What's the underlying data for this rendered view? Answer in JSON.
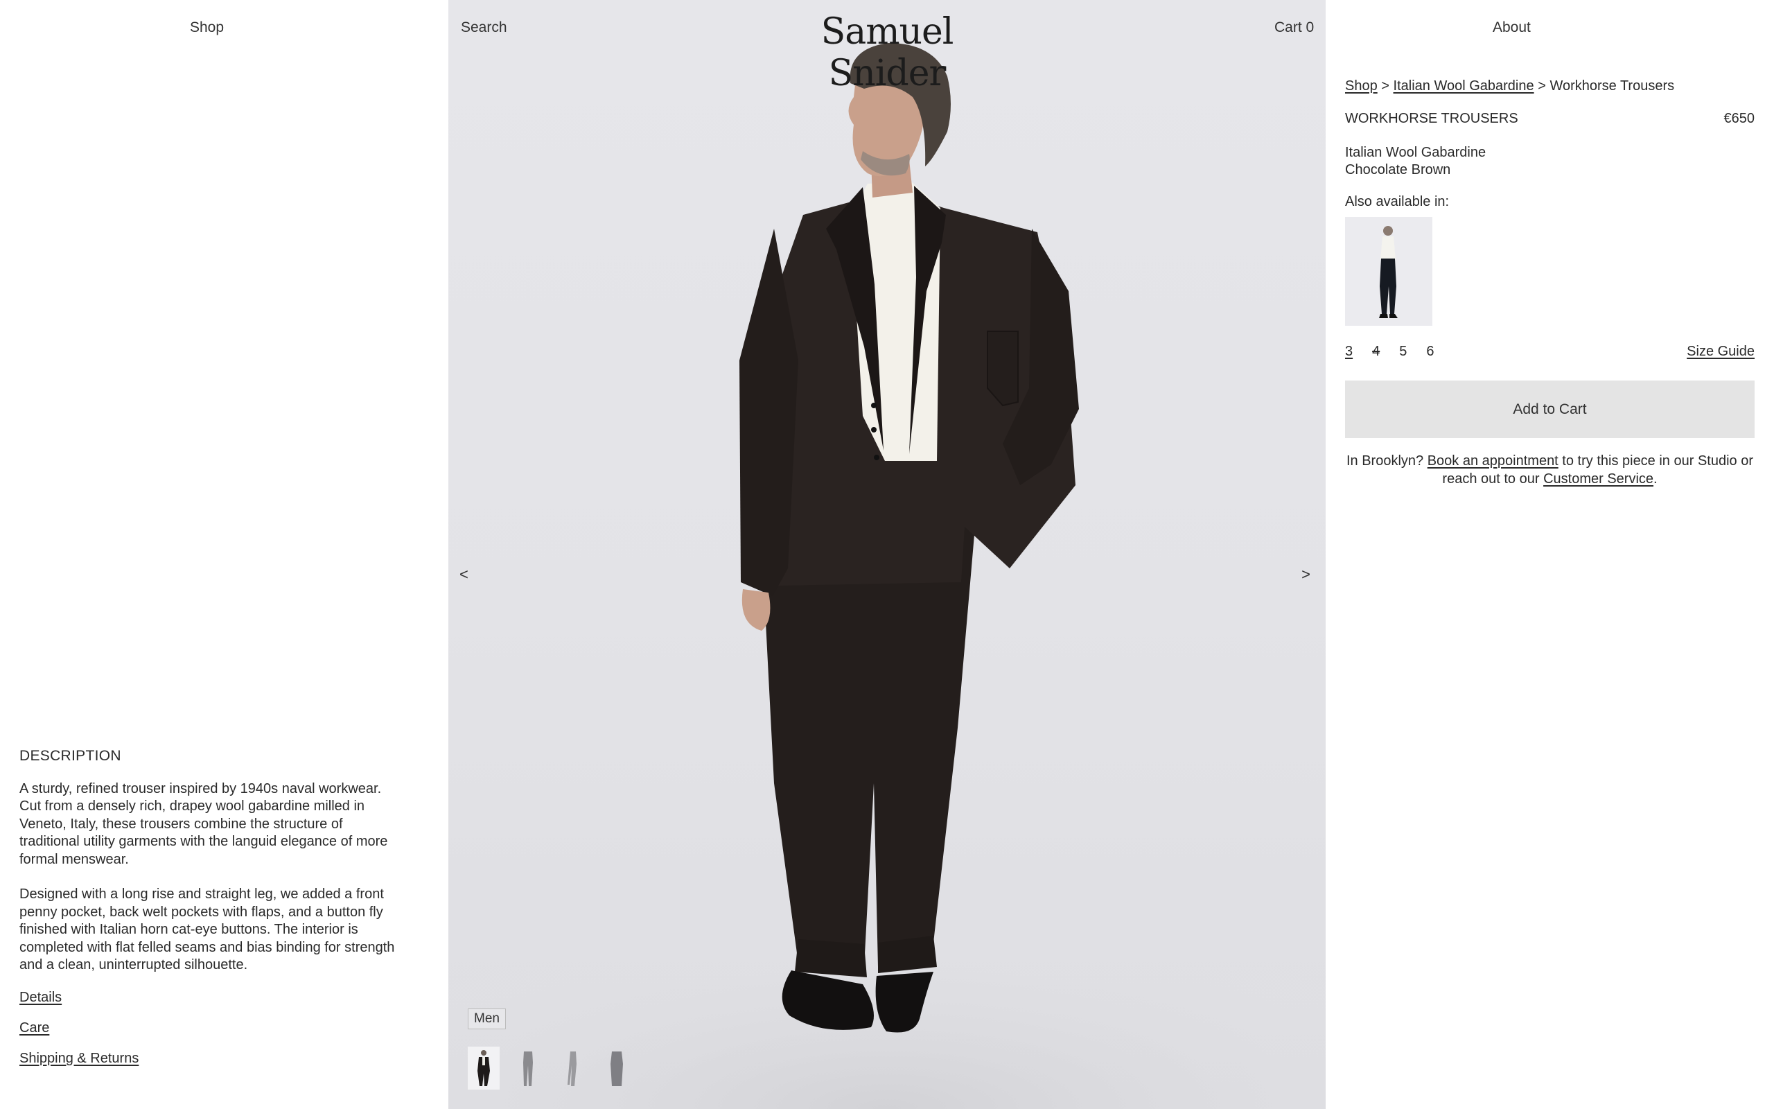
{
  "header": {
    "nav_left": "Shop",
    "nav_search": "Search",
    "brand": "Samuel Snider",
    "cart": "Cart 0",
    "nav_about": "About"
  },
  "gallery": {
    "prev": "<",
    "next": ">",
    "tag": "Men",
    "thumbnail_count": 4,
    "active_thumbnail": 1
  },
  "description": {
    "heading": "DESCRIPTION",
    "paragraphs": [
      "A sturdy, refined trouser inspired by 1940s naval workwear. Cut from a densely rich, drapey wool gabardine milled in Veneto, Italy, these trousers combine the structure of traditional utility garments with the languid elegance of more formal menswear.",
      "Designed with a long rise and straight leg, we added a front penny pocket, back welt pockets with flaps, and a button fly finished with Italian horn cat-eye buttons. The interior is completed with flat felled seams and bias binding for strength and a clean, uninterrupted silhouette."
    ],
    "links": [
      "Details",
      "Care",
      "Shipping & Returns"
    ]
  },
  "product": {
    "breadcrumb": {
      "shop": "Shop",
      "sep": ">",
      "collection": "Italian Wool Gabardine",
      "current": "Workhorse Trousers"
    },
    "name": "WORKHORSE TROUSERS",
    "price": "€650",
    "fabric": "Italian Wool Gabardine",
    "color": "Chocolate Brown",
    "also_available_label": "Also available in:",
    "sizes": [
      "3",
      "4",
      "5",
      "6"
    ],
    "selected_size": "3",
    "unavailable_size": "4",
    "size_guide": "Size Guide",
    "add_to_cart": "Add to Cart",
    "note": {
      "prefix": "In Brooklyn? ",
      "appointment_link": "Book an appointment",
      "middle": " to try this piece in our Studio or reach out to our ",
      "service_link": "Customer Service",
      "suffix": "."
    }
  },
  "colors": {
    "backdrop": "#e4e4e8",
    "suit": "#2a2321",
    "shirt": "#f3f1ea",
    "button_bg": "#e4e4e4",
    "text": "#2a2a2a"
  }
}
